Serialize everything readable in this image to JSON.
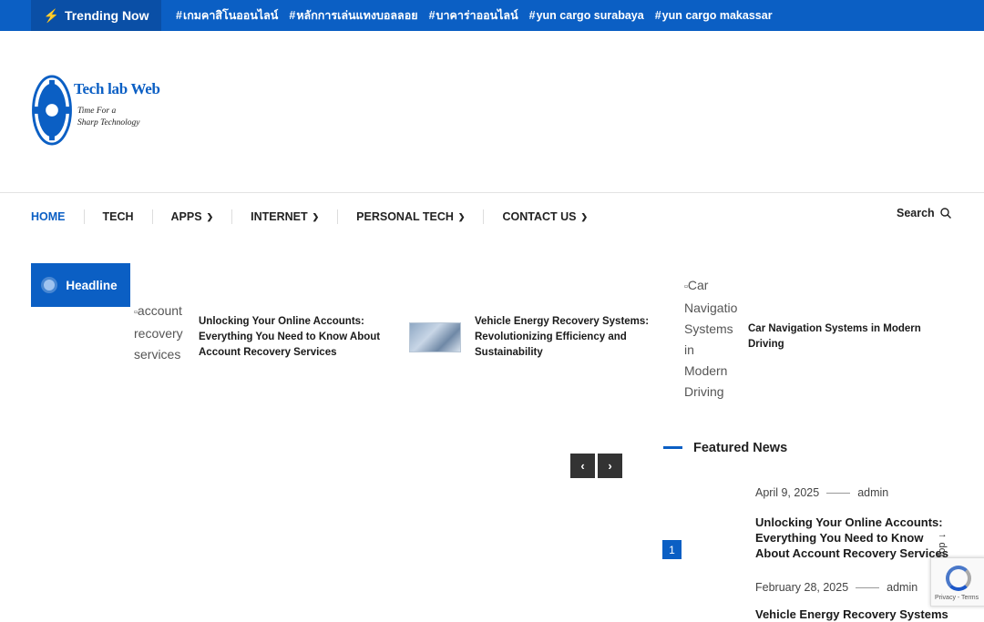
{
  "trending": {
    "label": "Trending Now",
    "tags": [
      "เกมคาสิโนออนไลน์",
      "หลักการเล่นแทงบอลลอย",
      "บาคาร่าออนไลน์",
      "yun cargo surabaya",
      "yun cargo makassar"
    ]
  },
  "logo": {
    "brand": "Tech lab Web",
    "tagline_1": "Time For a",
    "tagline_2": "Sharp Technology"
  },
  "nav": {
    "items": [
      {
        "label": "HOME",
        "dropdown": false
      },
      {
        "label": "TECH",
        "dropdown": false
      },
      {
        "label": "APPS",
        "dropdown": true
      },
      {
        "label": "INTERNET",
        "dropdown": true
      },
      {
        "label": "PERSONAL TECH",
        "dropdown": true
      },
      {
        "label": "CONTACT US",
        "dropdown": true
      }
    ],
    "search_label": "Search"
  },
  "headline": {
    "label": "Headline",
    "items": [
      {
        "alt": "account recovery services",
        "title": "Unlocking Your Online Accounts: Everything You Need to Know About Account Recovery Services"
      },
      {
        "alt": "",
        "title": "Vehicle Energy Recovery Systems: Revolutionizing Efficiency and Sustainability"
      },
      {
        "alt": "Car Navigation Systems in Modern Driving",
        "title": "Car Navigation Systems in Modern Driving"
      }
    ]
  },
  "featured": {
    "title": "Featured News",
    "rank": "1",
    "items": [
      {
        "date": "April 9, 2025",
        "author": "admin",
        "title": "Unlocking Your Online Accounts: Everything You Need to Know About Account Recovery Services"
      },
      {
        "date": "February 28, 2025",
        "author": "admin",
        "title": "Vehicle Energy Recovery Systems"
      }
    ]
  },
  "back_to_top": "Back To Top",
  "recaptcha": "Privacy - Terms",
  "colors": {
    "primary": "#0b5fc4",
    "primary_dark": "#0a4fa6"
  }
}
